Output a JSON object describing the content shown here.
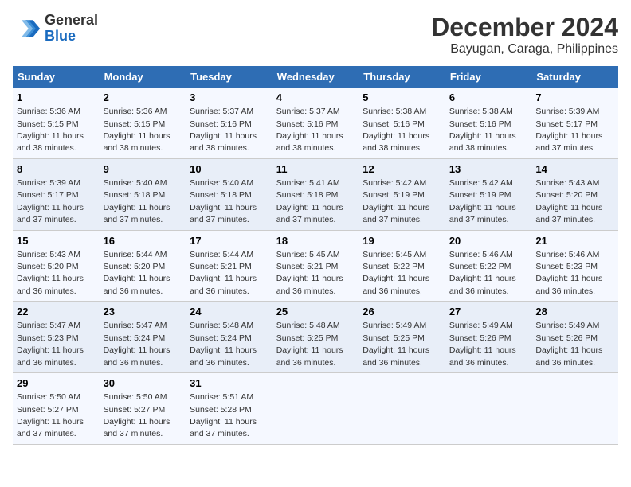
{
  "header": {
    "logo_general": "General",
    "logo_blue": "Blue",
    "month_title": "December 2024",
    "location": "Bayugan, Caraga, Philippines"
  },
  "days_of_week": [
    "Sunday",
    "Monday",
    "Tuesday",
    "Wednesday",
    "Thursday",
    "Friday",
    "Saturday"
  ],
  "weeks": [
    [
      {
        "day": "1",
        "sunrise": "5:36 AM",
        "sunset": "5:15 PM",
        "daylight": "11 hours and 38 minutes."
      },
      {
        "day": "2",
        "sunrise": "5:36 AM",
        "sunset": "5:15 PM",
        "daylight": "11 hours and 38 minutes."
      },
      {
        "day": "3",
        "sunrise": "5:37 AM",
        "sunset": "5:16 PM",
        "daylight": "11 hours and 38 minutes."
      },
      {
        "day": "4",
        "sunrise": "5:37 AM",
        "sunset": "5:16 PM",
        "daylight": "11 hours and 38 minutes."
      },
      {
        "day": "5",
        "sunrise": "5:38 AM",
        "sunset": "5:16 PM",
        "daylight": "11 hours and 38 minutes."
      },
      {
        "day": "6",
        "sunrise": "5:38 AM",
        "sunset": "5:16 PM",
        "daylight": "11 hours and 38 minutes."
      },
      {
        "day": "7",
        "sunrise": "5:39 AM",
        "sunset": "5:17 PM",
        "daylight": "11 hours and 37 minutes."
      }
    ],
    [
      {
        "day": "8",
        "sunrise": "5:39 AM",
        "sunset": "5:17 PM",
        "daylight": "11 hours and 37 minutes."
      },
      {
        "day": "9",
        "sunrise": "5:40 AM",
        "sunset": "5:18 PM",
        "daylight": "11 hours and 37 minutes."
      },
      {
        "day": "10",
        "sunrise": "5:40 AM",
        "sunset": "5:18 PM",
        "daylight": "11 hours and 37 minutes."
      },
      {
        "day": "11",
        "sunrise": "5:41 AM",
        "sunset": "5:18 PM",
        "daylight": "11 hours and 37 minutes."
      },
      {
        "day": "12",
        "sunrise": "5:42 AM",
        "sunset": "5:19 PM",
        "daylight": "11 hours and 37 minutes."
      },
      {
        "day": "13",
        "sunrise": "5:42 AM",
        "sunset": "5:19 PM",
        "daylight": "11 hours and 37 minutes."
      },
      {
        "day": "14",
        "sunrise": "5:43 AM",
        "sunset": "5:20 PM",
        "daylight": "11 hours and 37 minutes."
      }
    ],
    [
      {
        "day": "15",
        "sunrise": "5:43 AM",
        "sunset": "5:20 PM",
        "daylight": "11 hours and 36 minutes."
      },
      {
        "day": "16",
        "sunrise": "5:44 AM",
        "sunset": "5:20 PM",
        "daylight": "11 hours and 36 minutes."
      },
      {
        "day": "17",
        "sunrise": "5:44 AM",
        "sunset": "5:21 PM",
        "daylight": "11 hours and 36 minutes."
      },
      {
        "day": "18",
        "sunrise": "5:45 AM",
        "sunset": "5:21 PM",
        "daylight": "11 hours and 36 minutes."
      },
      {
        "day": "19",
        "sunrise": "5:45 AM",
        "sunset": "5:22 PM",
        "daylight": "11 hours and 36 minutes."
      },
      {
        "day": "20",
        "sunrise": "5:46 AM",
        "sunset": "5:22 PM",
        "daylight": "11 hours and 36 minutes."
      },
      {
        "day": "21",
        "sunrise": "5:46 AM",
        "sunset": "5:23 PM",
        "daylight": "11 hours and 36 minutes."
      }
    ],
    [
      {
        "day": "22",
        "sunrise": "5:47 AM",
        "sunset": "5:23 PM",
        "daylight": "11 hours and 36 minutes."
      },
      {
        "day": "23",
        "sunrise": "5:47 AM",
        "sunset": "5:24 PM",
        "daylight": "11 hours and 36 minutes."
      },
      {
        "day": "24",
        "sunrise": "5:48 AM",
        "sunset": "5:24 PM",
        "daylight": "11 hours and 36 minutes."
      },
      {
        "day": "25",
        "sunrise": "5:48 AM",
        "sunset": "5:25 PM",
        "daylight": "11 hours and 36 minutes."
      },
      {
        "day": "26",
        "sunrise": "5:49 AM",
        "sunset": "5:25 PM",
        "daylight": "11 hours and 36 minutes."
      },
      {
        "day": "27",
        "sunrise": "5:49 AM",
        "sunset": "5:26 PM",
        "daylight": "11 hours and 36 minutes."
      },
      {
        "day": "28",
        "sunrise": "5:49 AM",
        "sunset": "5:26 PM",
        "daylight": "11 hours and 36 minutes."
      }
    ],
    [
      {
        "day": "29",
        "sunrise": "5:50 AM",
        "sunset": "5:27 PM",
        "daylight": "11 hours and 37 minutes."
      },
      {
        "day": "30",
        "sunrise": "5:50 AM",
        "sunset": "5:27 PM",
        "daylight": "11 hours and 37 minutes."
      },
      {
        "day": "31",
        "sunrise": "5:51 AM",
        "sunset": "5:28 PM",
        "daylight": "11 hours and 37 minutes."
      },
      null,
      null,
      null,
      null
    ]
  ]
}
